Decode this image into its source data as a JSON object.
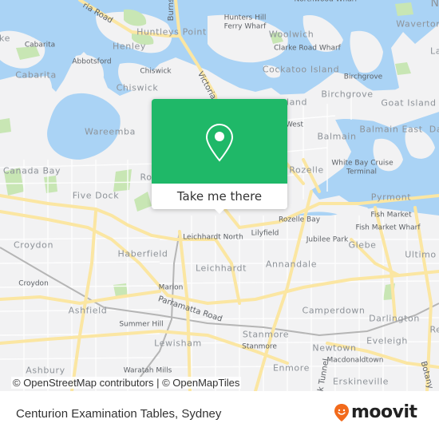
{
  "map": {
    "colors": {
      "water": "#aad3f5",
      "land": "#f2f2f3",
      "park": "#c8e6b4",
      "road_major": "#fbe6a2",
      "road_minor": "#ffffff",
      "rail": "#b5b5b5",
      "brand_green": "#1fb868",
      "brand_orange": "#f26a1b"
    },
    "labels": {
      "huntleys_point": "Huntleys Point",
      "henley": "Henley",
      "abbotsford": "Abbotsford",
      "cabarita_small": "Cabarita",
      "cabarita": "Cabarita",
      "chiswick_small": "Chiswick",
      "chiswick": "Chiswick",
      "wareemba": "Wareemba",
      "canada_bay": "Canada Bay",
      "five_dock": "Five Dock",
      "croydon": "Croydon",
      "croydon_small": "Croydon",
      "haberfield": "Haberfield",
      "ashfield": "Ashfield",
      "summer_hill": "Summer Hill",
      "lewisham": "Lewisham",
      "ashbury": "Ashbury",
      "waratah_mills": "Waratah Mills",
      "marion": "Marion",
      "leichhardt": "Leichhardt",
      "leichhardt_north": "Leichhardt North",
      "lilyfield": "Lilyfield",
      "annandale": "Annandale",
      "rozelle": "Rozelle",
      "rozelle_bay": "Rozelle Bay",
      "jubilee_park": "Jubilee Park",
      "glebe": "Glebe",
      "ultimo": "Ultimo",
      "pyrmont": "Pyrmont",
      "fish_market": "Fish Market",
      "fish_market_wharf": "Fish Market Wharf",
      "white_bay": "White Bay Cruise",
      "white_bay_2": "Terminal",
      "balmain": "Balmain",
      "balmain_east": "Balmain East",
      "balmain_west": "West",
      "birchgrove": "Birchgrove",
      "birchgrove_small": "Birchgrove",
      "goat_island": "Goat Island",
      "cockatoo_island": "Cockatoo Island",
      "clarke_road_wharf": "Clarke Road Wharf",
      "woolwich": "Woolwich",
      "hunters_hill_1": "Hunters Hill",
      "hunters_hill_2": "Ferry Wharf",
      "northwood_wharf": "Northwood Wharf",
      "waverton": "Waverton",
      "camperdown": "Camperdown",
      "darlington": "Darlington",
      "stanmore": "Stanmore",
      "stanmore_small": "Stanmore",
      "newtown": "Newtown",
      "eveleigh": "Eveleigh",
      "macdonaldtown": "Macdonaldtown",
      "enmore": "Enmore",
      "erskineville": "Erskineville",
      "parramatta_road": "Parramatta Road",
      "victoria_road": "Victoria Road",
      "victoria_road_nw": "ria Road",
      "burns": "Burns",
      "botany": "Botany",
      "tunnel": "k Tunnel",
      "ro_partial": "Ro",
      "iand_partial": "land",
      "ke_partial": "ke",
      "da_partial": "Da",
      "la_partial": "La",
      "re_partial": "Re",
      "n_partial": "N"
    }
  },
  "popup": {
    "icon": "map-pin-icon",
    "button_label": "Take me there"
  },
  "attribution": "© OpenStreetMap contributors | © OpenMapTiles",
  "footer": {
    "title": "Centurion Examination Tables, Sydney",
    "logo_text": "moovit",
    "logo_icon": "moovit-smile-pin-icon"
  }
}
